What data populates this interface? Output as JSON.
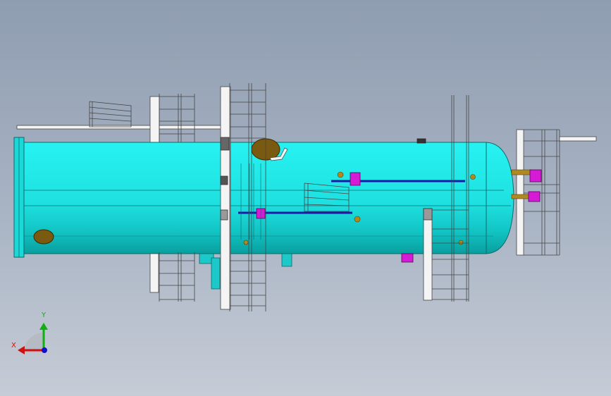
{
  "viewport": {
    "background_top": "#8f9db1",
    "background_bottom": "#c6ccd6"
  },
  "model": {
    "vessel_color": "#22e6e6",
    "vessel_dark": "#0aa5a5",
    "nozzle_color": "#d61bd6",
    "pipe_color": "#1a1aa8",
    "manway_color": "#7a5a10",
    "steel_color": "#f2f2f2"
  },
  "triad": {
    "x_label": "X",
    "y_label": "Y",
    "x_color": "#d01010",
    "y_color": "#10b010",
    "z_color": "#1010d0",
    "icon": "coordinate-triad-icon"
  }
}
